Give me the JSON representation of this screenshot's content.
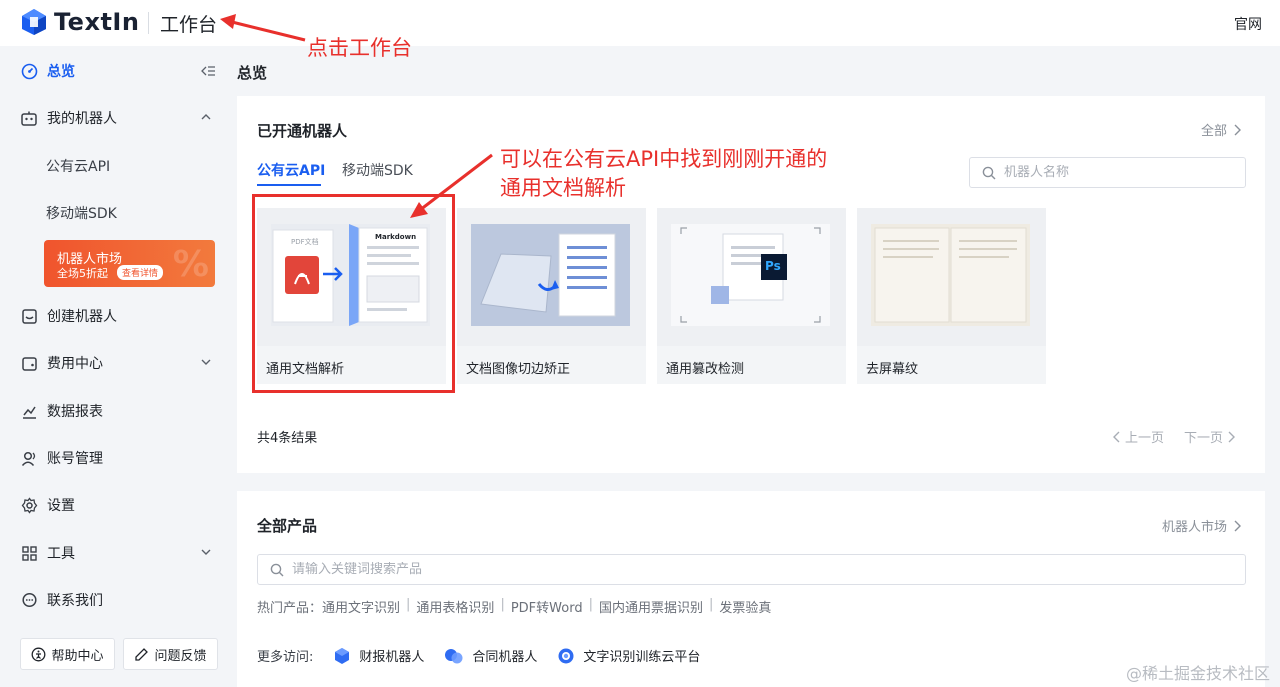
{
  "header": {
    "logo_text": "TextIn",
    "workbench_title": "工作台",
    "official_link": "官网"
  },
  "sidebar": {
    "items": [
      {
        "label": "总览",
        "icon": "dashboard-icon",
        "active": true
      },
      {
        "label": "我的机器人",
        "icon": "robot-icon",
        "expanded": true
      },
      {
        "label": "公有云API",
        "sub": true
      },
      {
        "label": "移动端SDK",
        "sub": true
      },
      {
        "label": "创建机器人",
        "icon": "create-icon"
      },
      {
        "label": "费用中心",
        "icon": "wallet-icon",
        "expandable": true
      },
      {
        "label": "数据报表",
        "icon": "chart-icon"
      },
      {
        "label": "账号管理",
        "icon": "account-icon"
      },
      {
        "label": "设置",
        "icon": "gear-icon"
      },
      {
        "label": "工具",
        "icon": "grid-icon",
        "expandable": true
      },
      {
        "label": "联系我们",
        "icon": "chat-icon"
      }
    ],
    "market_card": {
      "title": "机器人市场",
      "subtitle": "全场5折起",
      "button": "查看详情"
    },
    "help_button": "帮助中心",
    "feedback_button": "问题反馈"
  },
  "main": {
    "page_title": "总览",
    "opened_robots": {
      "title": "已开通机器人",
      "all_link": "全部",
      "tabs": [
        "公有云API",
        "移动端SDK"
      ],
      "active_tab": 0,
      "search_placeholder": "机器人名称",
      "cards": [
        {
          "label": "通用文档解析",
          "thumb_text": "Markdown",
          "thumb_sub": "PDF文档"
        },
        {
          "label": "文档图像切边矫正"
        },
        {
          "label": "通用篡改检测",
          "thumb_text": "Ps"
        },
        {
          "label": "去屏幕纹"
        }
      ],
      "result_count": "共4条结果",
      "prev_page": "上一页",
      "next_page": "下一页"
    },
    "all_products": {
      "title": "全部产品",
      "market_link": "机器人市场",
      "search_placeholder": "请输入关键词搜索产品",
      "hot_label": "热门产品：",
      "hot_items": [
        "通用文字识别",
        "通用表格识别",
        "PDF转Word",
        "国内通用票据识别",
        "发票验真"
      ],
      "more_label": "更多访问:",
      "more_items": [
        "财报机器人",
        "合同机器人",
        "文字识别训练云平台"
      ]
    }
  },
  "annotations": {
    "workbench_note": "点击工作台",
    "api_note_line1": "可以在公有云API中找到刚刚开通的",
    "api_note_line2": "通用文档解析"
  },
  "watermark": "@稀土掘金技术社区",
  "colors": {
    "primary": "#1a5ef0",
    "annotation": "#e8302c",
    "market_card": "#f0542d",
    "background": "#f3f5f8"
  }
}
